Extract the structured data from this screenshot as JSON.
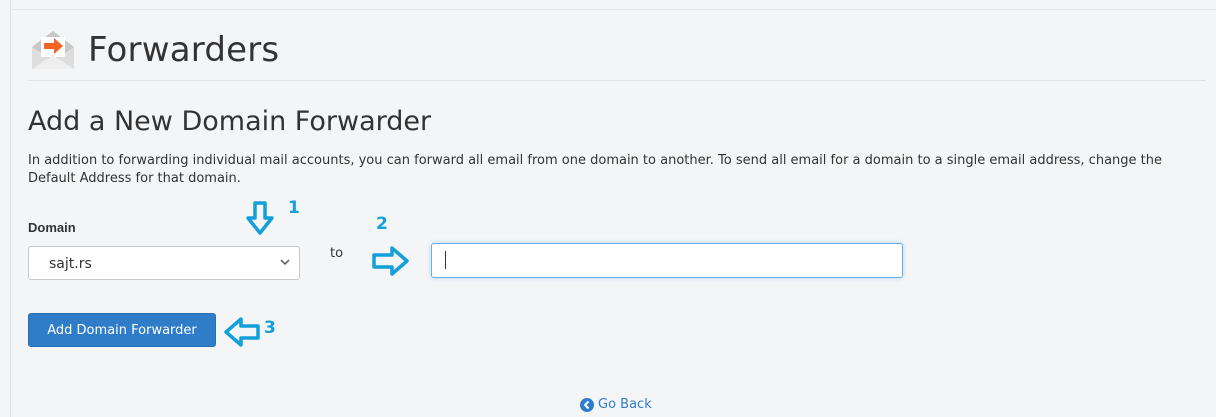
{
  "header": {
    "title": "Forwarders",
    "icon": "envelope-forward-icon",
    "accent_color": "#f26522"
  },
  "section": {
    "title": "Add a New Domain Forwarder",
    "description": "In addition to forwarding individual mail accounts, you can forward all email from one domain to another. To send all email for a domain to a single email address, change the Default Address for that domain."
  },
  "form": {
    "domain_label": "Domain",
    "domain_value": "sajt.rs",
    "to_label": "to",
    "target_value": "",
    "submit_label": "Add Domain Forwarder",
    "button_color": "#2f7dc9"
  },
  "annotations": [
    {
      "number": "1",
      "icon": "arrow-down-icon"
    },
    {
      "number": "2",
      "icon": "arrow-right-icon"
    },
    {
      "number": "3",
      "icon": "arrow-left-icon"
    }
  ],
  "annotation_color": "#139fd8",
  "footer": {
    "go_back_label": "Go Back",
    "icon": "circle-arrow-left-icon"
  }
}
